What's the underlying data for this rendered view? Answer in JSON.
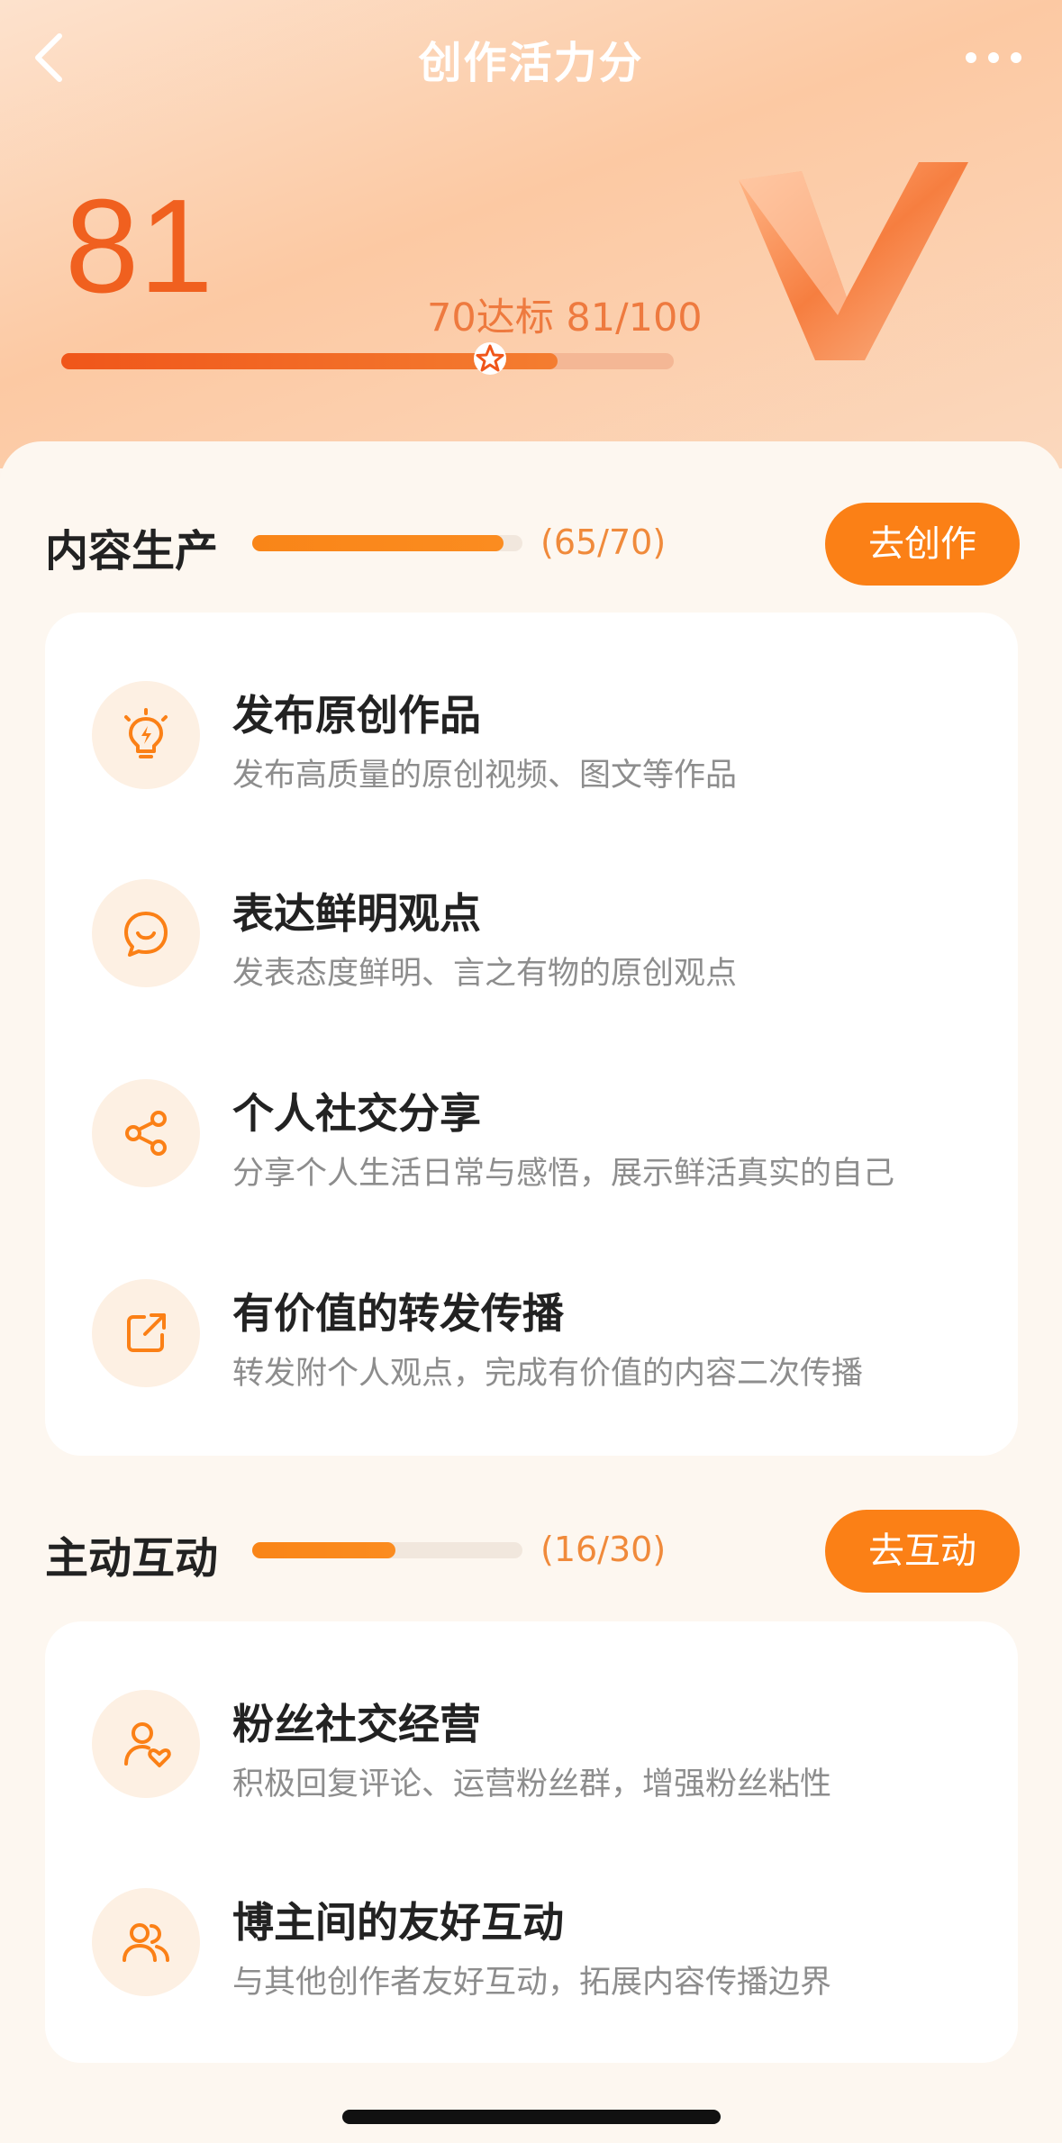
{
  "header": {
    "title": "创作活力分",
    "score": "81",
    "target_text": "70达标 81/100",
    "score_fraction": 0.81,
    "threshold_fraction": 0.7
  },
  "sections": [
    {
      "title": "内容生产",
      "count": "(65/70)",
      "progress": 0.93,
      "button": "去创作",
      "items": [
        {
          "icon": "lightbulb-icon",
          "title": "发布原创作品",
          "desc": "发布高质量的原创视频、图文等作品"
        },
        {
          "icon": "smile-chat-icon",
          "title": "表达鲜明观点",
          "desc": "发表态度鲜明、言之有物的原创观点"
        },
        {
          "icon": "share-icon",
          "title": "个人社交分享",
          "desc": "分享个人生活日常与感悟，展示鲜活真实的自己"
        },
        {
          "icon": "forward-icon",
          "title": "有价值的转发传播",
          "desc": "转发附个人观点，完成有价值的内容二次传播"
        }
      ]
    },
    {
      "title": "主动互动",
      "count": "(16/30)",
      "progress": 0.53,
      "button": "去互动",
      "items": [
        {
          "icon": "user-heart-icon",
          "title": "粉丝社交经营",
          "desc": "积极回复评论、运营粉丝群，增强粉丝粘性"
        },
        {
          "icon": "users-icon",
          "title": "博主间的友好互动",
          "desc": "与其他创作者友好互动，拓展内容传播边界"
        }
      ]
    }
  ],
  "colors": {
    "accent": "#fb8016",
    "score": "#f0601f",
    "header_bg": "#fcc9a3"
  }
}
